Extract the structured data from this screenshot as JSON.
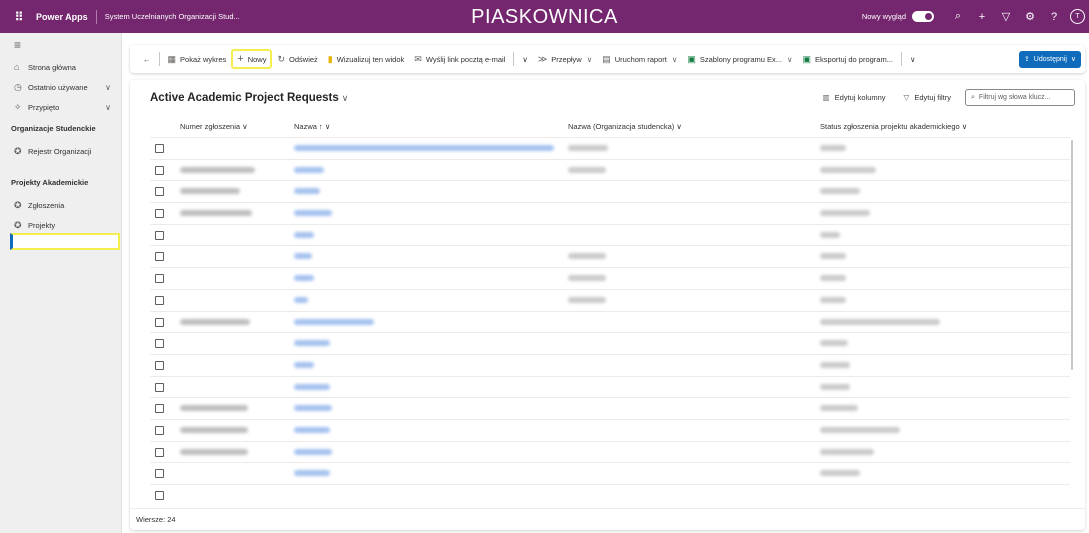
{
  "topbar": {
    "app_name": "Power Apps",
    "env_name": "System Uczelnianych Organizacji Stud...",
    "sandbox_label": "PIASKOWNICA",
    "new_look_label": "Nowy wygląd",
    "new_look_on": true,
    "avatar_initial": "T"
  },
  "sidebar": {
    "home": "Strona główna",
    "recent": "Ostatnio używane",
    "pinned": "Przypięto",
    "group1": "Organizacje Studenckie",
    "group1_items": [
      "Rejestr Organizacji"
    ],
    "group2": "Projekty Akademickie",
    "group2_items": [
      "Zgłoszenia",
      "Projekty"
    ],
    "active_item": "Zgłoszenia"
  },
  "commandbar": {
    "back": "←",
    "show_chart": "Pokaż wykres",
    "new": "Nowy",
    "refresh": "Odśwież",
    "visualize": "Wizualizuj ten widok",
    "email_link": "Wyślij link pocztą e-mail",
    "flow": "Przepływ",
    "run_report": "Uruchom raport",
    "excel_templates": "Szablony programu Ex...",
    "export": "Eksportuj do program...",
    "share": "Udostępnij"
  },
  "view": {
    "title": "Active Academic Project Requests",
    "edit_columns": "Edytuj kolumny",
    "edit_filters": "Edytuj filtry",
    "filter_placeholder": "Filtruj wg słowa klucz...",
    "columns": [
      "Numer zgłoszenia",
      "Nazwa",
      "Nazwa (Organizacja studencka)",
      "Status zgłoszenia projektu akademickiego"
    ],
    "name_sort_indicator": "↑",
    "visible_rows": 17,
    "row_count_label": "Wiersze: 24"
  },
  "colors": {
    "topbar": "#74276f",
    "accent": "#0f6cbd",
    "highlight": "#f4ee4f"
  }
}
